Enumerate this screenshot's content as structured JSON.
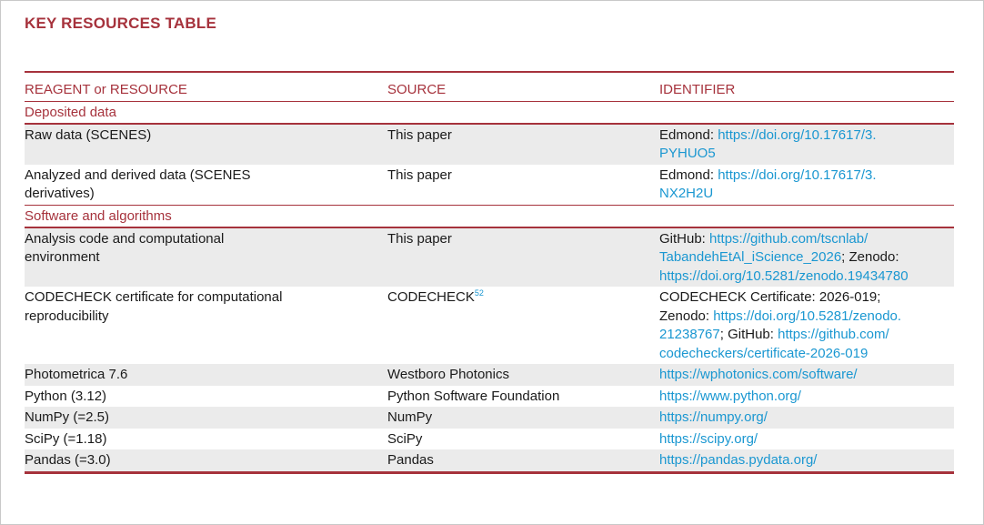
{
  "title": "KEY RESOURCES TABLE",
  "headers": {
    "col1": "REAGENT or RESOURCE",
    "col2": "SOURCE",
    "col3": "IDENTIFIER"
  },
  "sections": {
    "deposited": "Deposited data",
    "software": "Software and algorithms"
  },
  "rows": [
    {
      "resource": "Raw data (SCENES)",
      "source": "This paper",
      "id_prefix": "Edmond: ",
      "id_link1": "https://doi.org/10.17617/3.",
      "id_link2": "PYHUO5"
    },
    {
      "resource": "Analyzed and derived data (SCENES",
      "resource2": "derivatives)",
      "source": "This paper",
      "id_prefix": "Edmond: ",
      "id_link1": "https://doi.org/10.17617/3.",
      "id_link2": "NX2H2U"
    },
    {
      "resource": "Analysis code and computational",
      "resource2": "environment",
      "source": "This paper",
      "id_prefix": "GitHub: ",
      "id_link1": "https://github.com/tscnlab/",
      "id_link2": "TabandehEtAl_iScience_2026",
      "id_mid": "; Zenodo:",
      "id_link3": "https://doi.org/10.5281/zenodo.19434780"
    },
    {
      "resource": "CODECHECK certificate for computational",
      "resource2": "reproducibility",
      "source": "CODECHECK",
      "source_sup": "52",
      "id_line1": "CODECHECK Certificate: 2026-019;",
      "id_prefix": "Zenodo: ",
      "id_link1": "https://doi.org/10.5281/zenodo.",
      "id_link2": "21238767",
      "id_mid": "; GitHub: ",
      "id_link3": "https://github.com/",
      "id_link4": "codecheckers/certificate-2026-019"
    },
    {
      "resource": "Photometrica 7.6",
      "source": "Westboro Photonics",
      "id_link1": "https://wphotonics.com/software/"
    },
    {
      "resource": "Python (3.12)",
      "source": "Python Software Foundation",
      "id_link1": "https://www.python.org/"
    },
    {
      "resource": "NumPy (=2.5)",
      "source": "NumPy",
      "id_link1": "https://numpy.org/"
    },
    {
      "resource": "SciPy (=1.18)",
      "source": "SciPy",
      "id_link1": "https://scipy.org/"
    },
    {
      "resource": "Pandas (=3.0)",
      "source": "Pandas",
      "id_link1": "https://pandas.pydata.org/"
    }
  ],
  "colors": {
    "accent": "#a6323c",
    "link": "#1a97d1",
    "shade": "#ebebeb"
  }
}
